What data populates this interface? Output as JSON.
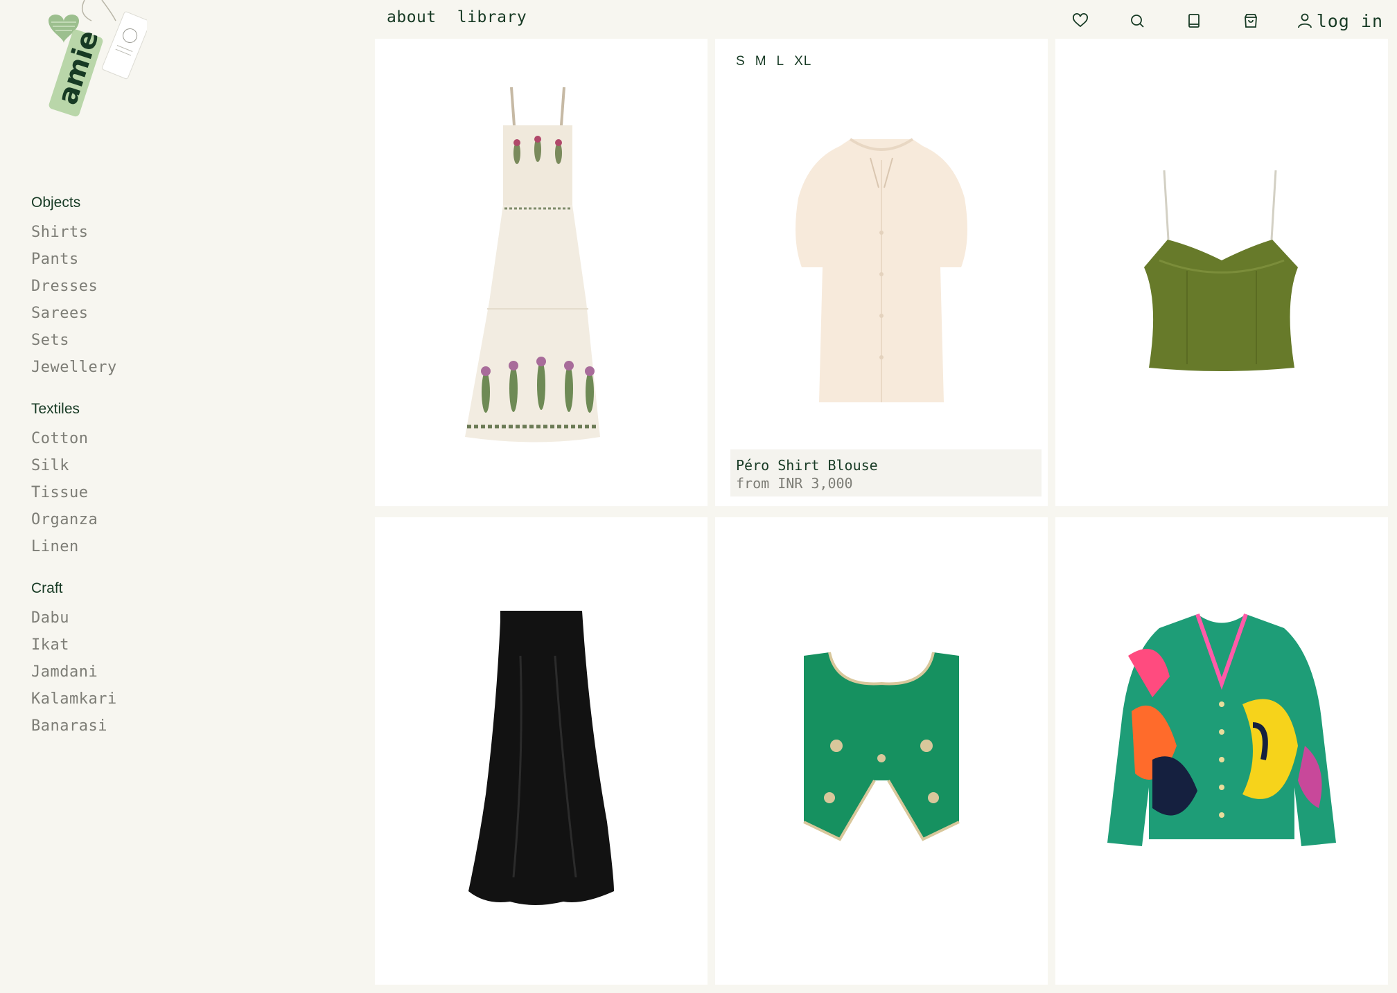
{
  "brand": {
    "logo_text": "amie"
  },
  "topnav": {
    "links": [
      "about",
      "library"
    ],
    "icons": [
      "heart-icon",
      "search-icon",
      "book-icon",
      "cart-icon",
      "user-icon"
    ],
    "login_label": "log in"
  },
  "sidebar": {
    "groups": [
      {
        "heading": "Objects",
        "items": [
          "Shirts",
          "Pants",
          "Dresses",
          "Sarees",
          "Sets",
          "Jewellery"
        ]
      },
      {
        "heading": "Textiles",
        "items": [
          "Cotton",
          "Silk",
          "Tissue",
          "Organza",
          "Linen"
        ]
      },
      {
        "heading": "Craft",
        "items": [
          "Dabu",
          "Ikat",
          "Jamdani",
          "Kalamkari",
          "Banarasi"
        ]
      }
    ]
  },
  "products": [
    {
      "image": "embroidered-cream-maxi-dress"
    },
    {
      "image": "cream-puff-sleeve-blouse",
      "sizes": [
        "S",
        "M",
        "L",
        "XL"
      ],
      "name": "Péro Shirt Blouse",
      "price": "from INR 3,000"
    },
    {
      "image": "olive-green-camisole"
    },
    {
      "image": "black-satin-midi-skirt"
    },
    {
      "image": "green-embroidered-vest"
    },
    {
      "image": "green-fish-print-cardigan"
    }
  ],
  "colors": {
    "background": "#f7f6f0",
    "text": "#173a24",
    "muted": "#7d7d76",
    "card": "#ffffff"
  }
}
